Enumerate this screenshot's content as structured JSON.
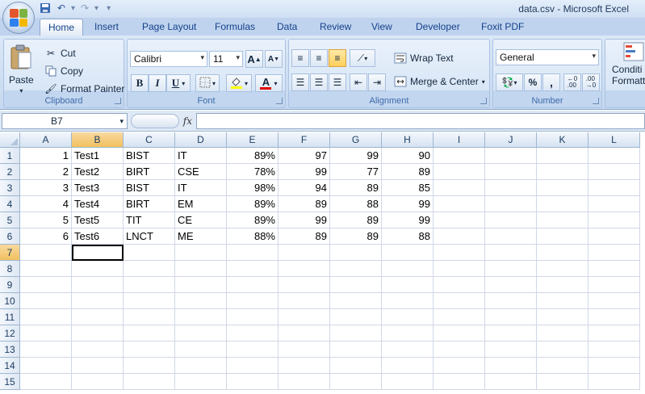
{
  "window": {
    "title": "data.csv - Microsoft Excel"
  },
  "tabs": [
    "Home",
    "Insert",
    "Page Layout",
    "Formulas",
    "Data",
    "Review",
    "View",
    "Developer",
    "Foxit PDF"
  ],
  "ribbon": {
    "clipboard": {
      "label": "Clipboard",
      "paste": "Paste",
      "cut": "Cut",
      "copy": "Copy",
      "format_painter": "Format Painter"
    },
    "font": {
      "label": "Font",
      "font_name": "Calibri",
      "font_size": "11",
      "bold": "B",
      "italic": "I",
      "underline": "U",
      "grow": "A",
      "shrink": "A",
      "font_color": "A"
    },
    "alignment": {
      "label": "Alignment",
      "wrap_text": "Wrap Text",
      "merge_center": "Merge & Center"
    },
    "number": {
      "label": "Number",
      "format": "General",
      "percent": "%",
      "comma": ","
    },
    "styles": {
      "conditional_line1": "Conditi",
      "conditional_line2": "Formatti"
    }
  },
  "formula_bar": {
    "name_box": "B7",
    "fx": "fx",
    "formula": ""
  },
  "sheet": {
    "columns": [
      "A",
      "B",
      "C",
      "D",
      "E",
      "F",
      "G",
      "H",
      "I",
      "J",
      "K",
      "L"
    ],
    "rows": [
      "1",
      "2",
      "3",
      "4",
      "5",
      "6",
      "7",
      "8",
      "9",
      "10",
      "11",
      "12",
      "13",
      "14",
      "15"
    ],
    "data": [
      [
        "1",
        "Test1",
        "BIST",
        "IT",
        "89%",
        "97",
        "99",
        "90"
      ],
      [
        "2",
        "Test2",
        "BIRT",
        "CSE",
        "78%",
        "99",
        "77",
        "89"
      ],
      [
        "3",
        "Test3",
        "BIST",
        "IT",
        "98%",
        "94",
        "89",
        "85"
      ],
      [
        "4",
        "Test4",
        "BIRT",
        "EM",
        "89%",
        "89",
        "88",
        "99"
      ],
      [
        "5",
        "Test5",
        "TIT",
        "CE",
        "89%",
        "99",
        "89",
        "99"
      ],
      [
        "6",
        "Test6",
        "LNCT",
        "ME",
        "88%",
        "89",
        "89",
        "88"
      ]
    ],
    "selected_cell": "B7"
  },
  "colors": {
    "ribbon_bg": "#c6d8ef",
    "selected_header": "#f1c15f",
    "gridline": "#d0d7e5"
  }
}
